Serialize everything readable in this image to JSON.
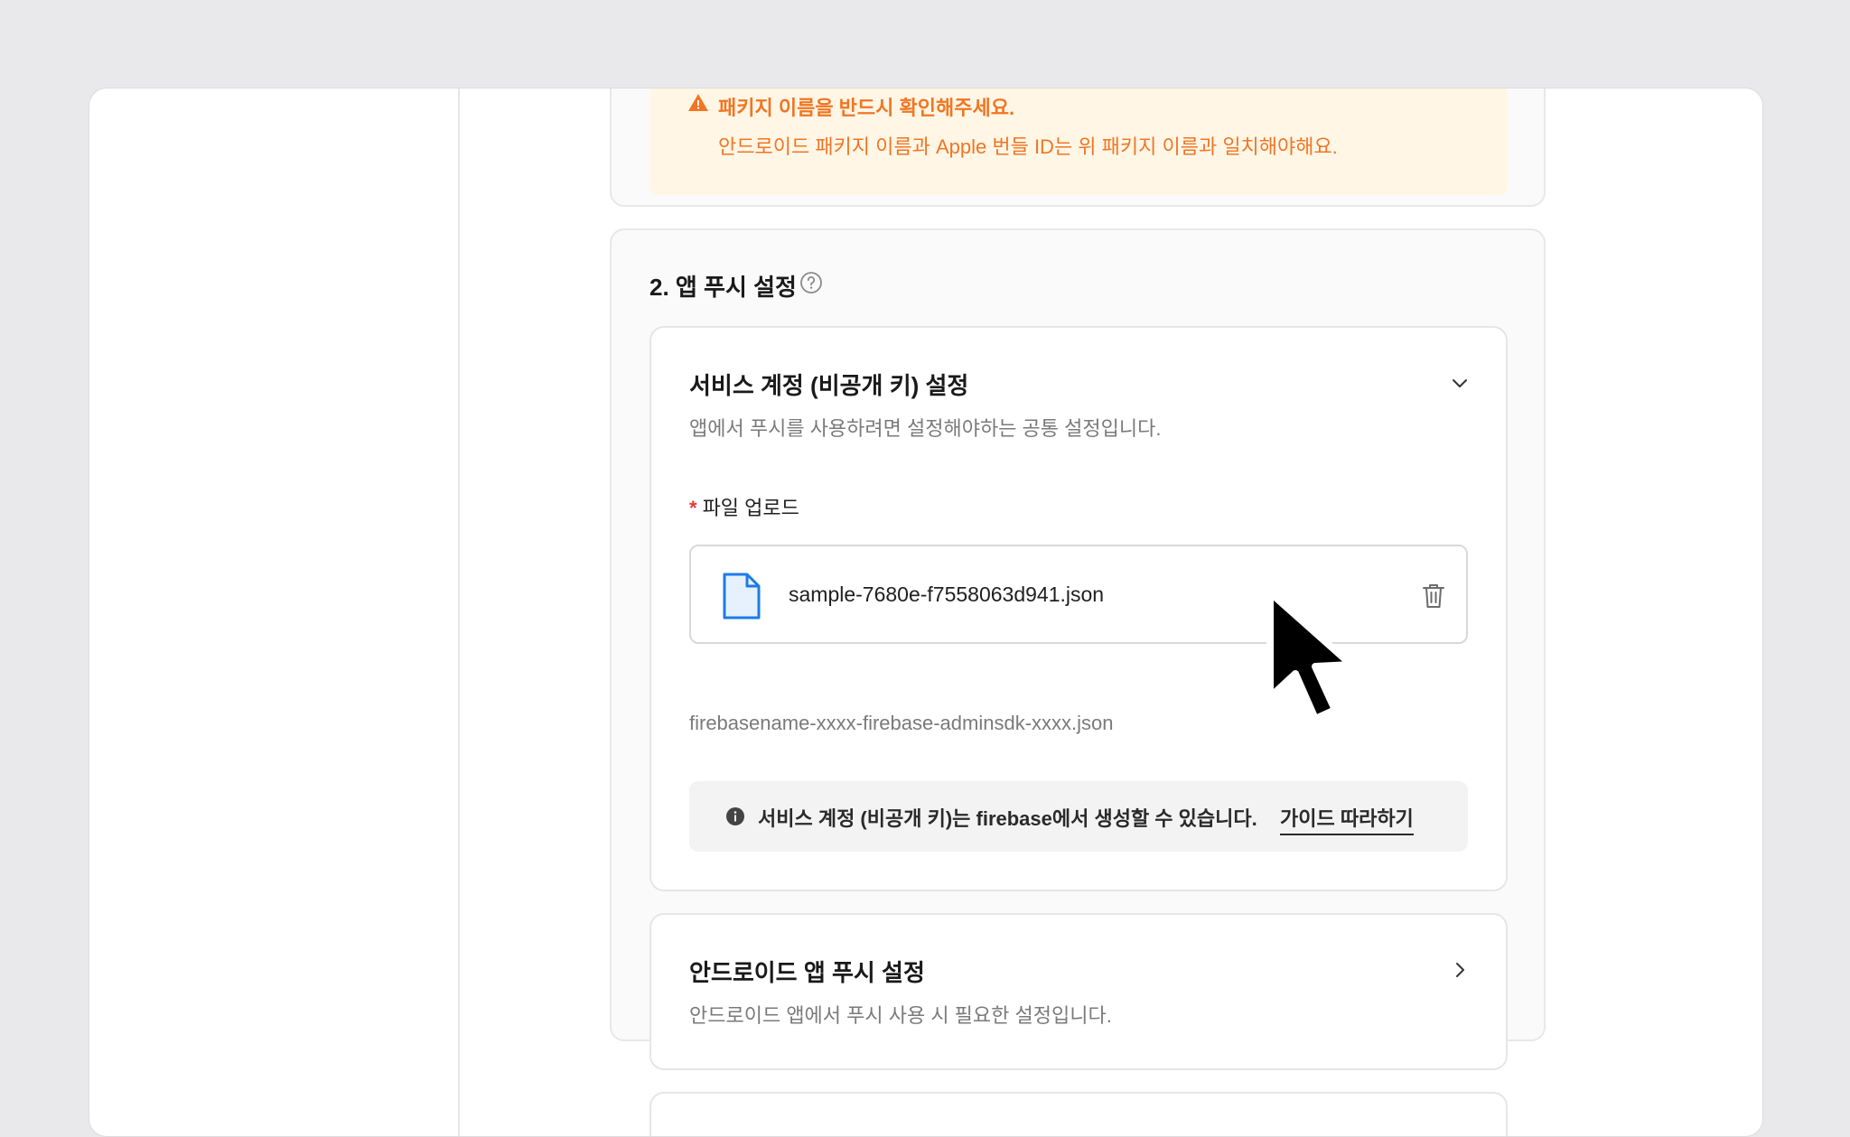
{
  "warning": {
    "title": "패키지 이름을 반드시 확인해주세요.",
    "text": "안드로이드 패키지 이름과 Apple 번들 ID는 위 패키지 이름과 일치해야해요."
  },
  "push_section": {
    "title": "2. 앱 푸시 설정",
    "service_account": {
      "title": "서비스 계정 (비공개 키) 설정",
      "subtitle": "앱에서 푸시를 사용하려면 설정해야하는 공통 설정입니다.",
      "required_mark": "*",
      "upload_label": "파일 업로드",
      "file_name": "sample-7680e-f7558063d941.json",
      "hint": "firebasename-xxxx-firebase-adminsdk-xxxx.json",
      "info_text": "서비스 계정 (비공개 키)는 firebase에서 생성할 수 있습니다.",
      "info_link": "가이드 따라하기"
    },
    "android": {
      "title": "안드로이드 앱 푸시 설정",
      "subtitle": "안드로이드 앱에서 푸시 사용 시 필요한 설정입니다."
    }
  },
  "icons": [
    "warning-icon",
    "help-circle-icon",
    "chevron-down-icon",
    "file-icon",
    "trash-icon",
    "info-icon",
    "chevron-right-icon",
    "mouse-cursor-icon"
  ],
  "colors": {
    "warning_text": "#f07624",
    "warning_bg": "#fff6e6",
    "file_icon": "#1e7be6",
    "required": "#e53935"
  }
}
